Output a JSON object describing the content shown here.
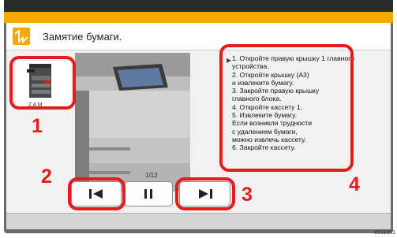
{
  "header": {
    "title": "Замятие бумаги."
  },
  "device": {
    "caption": "2 A M"
  },
  "instructions": [
    "1. Откройте правую крышку 1 главного",
    "устройства.",
    "2. Откройте крышку (A3)",
    "и извлеките бумагу.",
    "3. Закройте правую крышку",
    "главного блока.",
    "4. Откройте кассету 1.",
    "5. Извлеките бумагу.",
    "Если возникли трудности",
    "с удалением бумаги,",
    "можно извлечь кассету.",
    "6. Закройте кассету."
  ],
  "callouts": {
    "n1": "1",
    "n2": "2",
    "n3": "3",
    "n4": "4"
  },
  "pager": {
    "page": "1/12"
  },
  "footer_code": "e011001",
  "colors": {
    "accent": "#f6a800",
    "callout": "#e41c1c"
  },
  "icons": {
    "header": "paper-jam-icon",
    "prev": "skip-back-icon",
    "pause": "pause-icon",
    "next": "skip-forward-icon"
  }
}
